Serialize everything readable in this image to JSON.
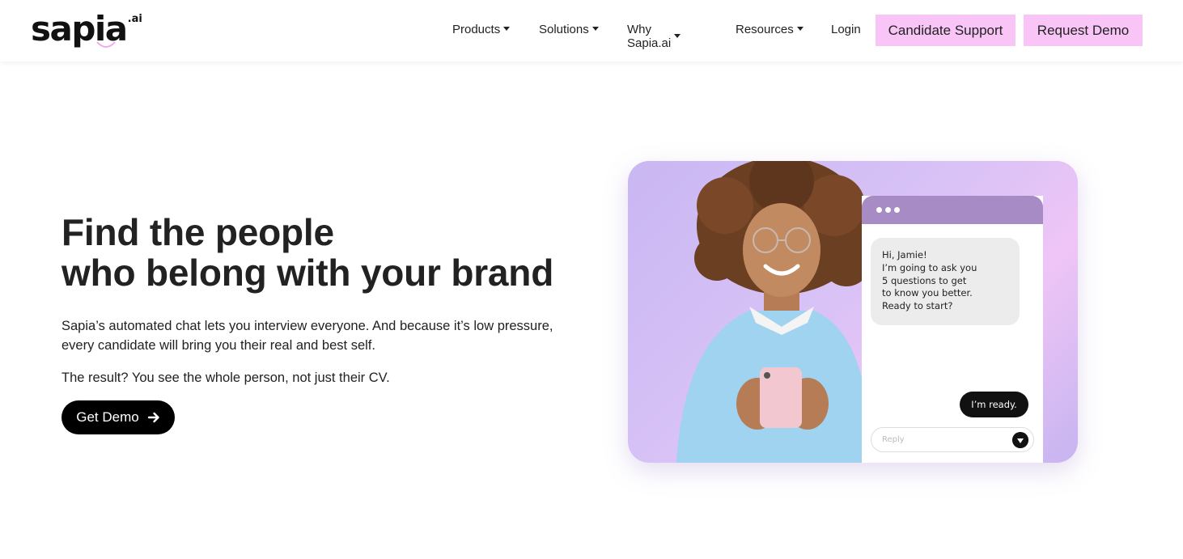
{
  "brand": {
    "logo_word": "sapia",
    "logo_sup": ".ai",
    "accent_pink": "#f8c5f6",
    "card_purple": "#a78bc4"
  },
  "nav": {
    "items": [
      {
        "label": "Products",
        "has_dropdown": true
      },
      {
        "label": "Solutions",
        "has_dropdown": true
      },
      {
        "label": "Why Sapia.ai",
        "has_dropdown": true
      },
      {
        "label": "Resources",
        "has_dropdown": true
      },
      {
        "label": "Login",
        "has_dropdown": false
      }
    ],
    "candidate_support": "Candidate Support",
    "request_demo": "Request Demo"
  },
  "hero": {
    "title_line1": "Find the people",
    "title_line2": "who belong with your brand",
    "paragraph1": "Sapia’s automated chat lets you interview everyone. And because it’s low pressure, every candidate will bring you their real and best self.",
    "paragraph2": "The result? You see the whole person, not just their CV.",
    "cta_label": "Get Demo",
    "cta_icon": "arrow-right-icon"
  },
  "chat": {
    "incoming_lines": [
      "Hi, Jamie!",
      "I’m going to ask you",
      "5 questions to get",
      "to know you better.",
      "Ready to start?"
    ],
    "outgoing": "I’m ready.",
    "reply_placeholder": "Reply",
    "send_icon": "send-icon"
  }
}
